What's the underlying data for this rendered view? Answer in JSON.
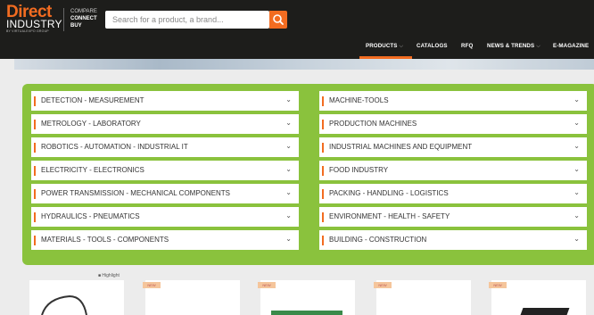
{
  "header": {
    "logo_line1": "Direct",
    "logo_line2": "INDUSTRY",
    "logo_line3": "BY VIRTUALEXPO GROUP",
    "tagline": [
      "COMPARE",
      "CONNECT",
      "BUY"
    ],
    "search_placeholder": "Search for a product, a brand...",
    "nav": [
      {
        "label": "PRODUCTS",
        "has_chevron": true,
        "active": true
      },
      {
        "label": "CATALOGS",
        "has_chevron": false
      },
      {
        "label": "RFQ",
        "has_chevron": false
      },
      {
        "label": "NEWS & TRENDS",
        "has_chevron": true
      },
      {
        "label": "E-MAGAZINE",
        "has_chevron": false
      }
    ],
    "accent": "#f26c21"
  },
  "categories": {
    "panel_color": "#8ac23d",
    "left": [
      "DETECTION - MEASUREMENT",
      "METROLOGY - LABORATORY",
      "ROBOTICS - AUTOMATION - INDUSTRIAL IT",
      "ELECTRICITY - ELECTRONICS",
      "POWER TRANSMISSION - MECHANICAL COMPONENTS",
      "HYDRAULICS - PNEUMATICS",
      "MATERIALS - TOOLS - COMPONENTS"
    ],
    "right": [
      "MACHINE-TOOLS",
      "PRODUCTION MACHINES",
      "INDUSTRIAL MACHINES AND EQUIPMENT",
      "FOOD INDUSTRY",
      "PACKING - HANDLING - LOGISTICS",
      "ENVIRONMENT - HEALTH - SAFETY",
      "BUILDING - CONSTRUCTION"
    ]
  },
  "products": {
    "highlight_label": "Highlight",
    "new_badge": "NEW"
  }
}
